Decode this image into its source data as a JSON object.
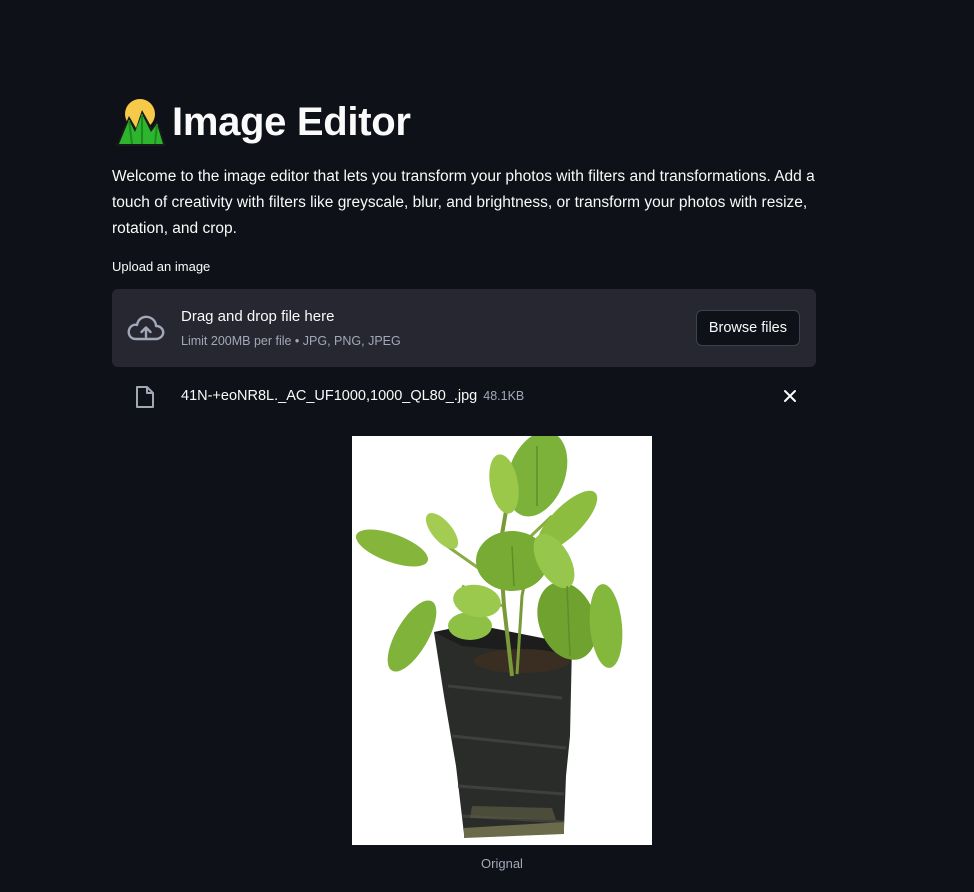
{
  "header": {
    "title": "Image Editor",
    "title_icon": "sunrise-over-mountains-icon"
  },
  "intro": {
    "text": "Welcome to the image editor that lets you transform your photos with filters and transformations. Add a touch of creativity with filters like greyscale, blur, and brightness, or transform your photos with resize, rotation, and crop."
  },
  "uploader": {
    "label": "Upload an image",
    "drop_title": "Drag and drop file here",
    "drop_limit": "Limit 200MB per file • JPG, PNG, JPEG",
    "browse_label": "Browse files",
    "icon": "cloud-upload-icon"
  },
  "file": {
    "name": "41N-+eoNR8L._AC_UF1000,1000_QL80_.jpg",
    "size": "48.1KB",
    "icon": "file-icon"
  },
  "preview": {
    "caption": "Orignal",
    "alt": "potted plant in black grow bag"
  },
  "colors": {
    "background": "#0e1117",
    "dropzone": "#262730",
    "text": "#fafafa",
    "muted": "#a3a8b8"
  }
}
